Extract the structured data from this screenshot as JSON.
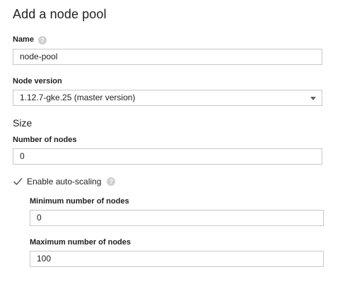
{
  "header": {
    "title": "Add a node pool"
  },
  "name_field": {
    "label": "Name",
    "help_icon": "help-circle-icon",
    "value": "node-pool"
  },
  "node_version": {
    "label": "Node version",
    "selected": "1.12.7-gke.25 (master version)",
    "dropdown_icon": "caret-down-icon"
  },
  "size": {
    "section_title": "Size",
    "number_of_nodes": {
      "label": "Number of nodes",
      "value": "0"
    },
    "autoscaling": {
      "label": "Enable auto-scaling",
      "checked": true,
      "help_icon": "help-circle-icon"
    },
    "min_nodes": {
      "label": "Minimum number of nodes",
      "value": "0"
    },
    "max_nodes": {
      "label": "Maximum number of nodes",
      "value": "100"
    }
  }
}
